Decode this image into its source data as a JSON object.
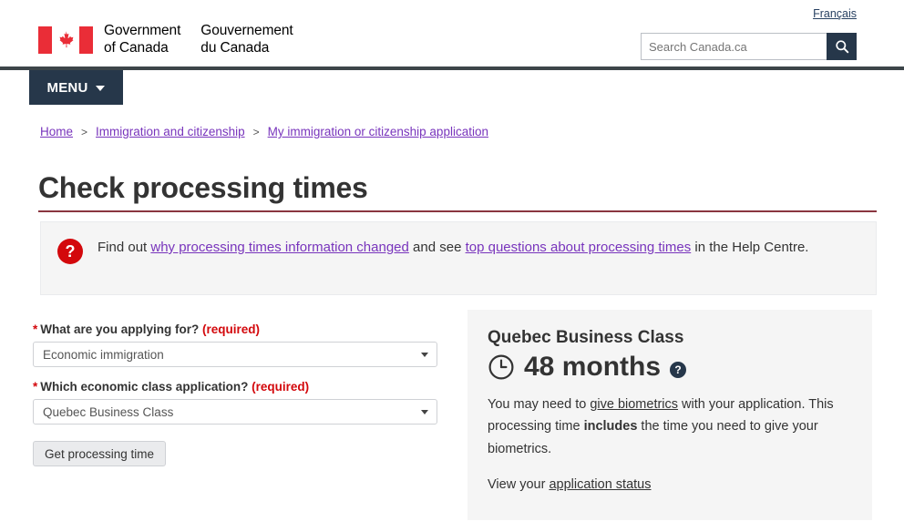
{
  "header": {
    "lang_toggle": "Français",
    "brand_en_line1": "Government",
    "brand_en_line2": "of Canada",
    "brand_fr_line1": "Gouvernement",
    "brand_fr_line2": "du Canada",
    "search_placeholder": "Search Canada.ca",
    "search_value": "",
    "search_icon": "search-icon",
    "flag_icon": "canada-flag-icon"
  },
  "menu": {
    "label": "MENU",
    "chevron_icon": "chevron-down-icon"
  },
  "breadcrumb": {
    "items": [
      {
        "label": "Home"
      },
      {
        "label": "Immigration and citizenship"
      },
      {
        "label": "My immigration or citizenship application"
      }
    ],
    "separator": ">"
  },
  "page": {
    "title": "Check processing times"
  },
  "alert": {
    "icon": "question-mark-icon",
    "text_before": "Find out ",
    "link1": "why processing times information changed",
    "text_middle": " and see ",
    "link2": "top questions about processing times",
    "text_after": " in the Help Centre."
  },
  "form": {
    "field1": {
      "star": "*",
      "label": "What are you applying for?",
      "required_note": "(required)",
      "value": "Economic immigration",
      "arrow_icon": "chevron-down-icon"
    },
    "field2": {
      "star": "*",
      "label": "Which economic class application?",
      "required_note": "(required)",
      "value": "Quebec Business Class",
      "arrow_icon": "chevron-down-icon"
    },
    "submit_label": "Get processing time"
  },
  "result": {
    "title": "Quebec Business Class",
    "clock_icon": "clock-icon",
    "processing_time": "48 months",
    "help_icon": "question-mark-icon",
    "body_part1": "You may need to ",
    "body_link": "give biometrics",
    "body_part2": " with your application. This processing time ",
    "body_bold": "includes",
    "body_part3": " the time you need to give your biometrics.",
    "footer_text": "View your ",
    "footer_link": "application status"
  },
  "colors": {
    "navy": "#26374A",
    "red": "#D3080C",
    "link_purple": "#7834BC",
    "panel_gray": "#F5F5F5",
    "title_rule": "#8A3640"
  }
}
